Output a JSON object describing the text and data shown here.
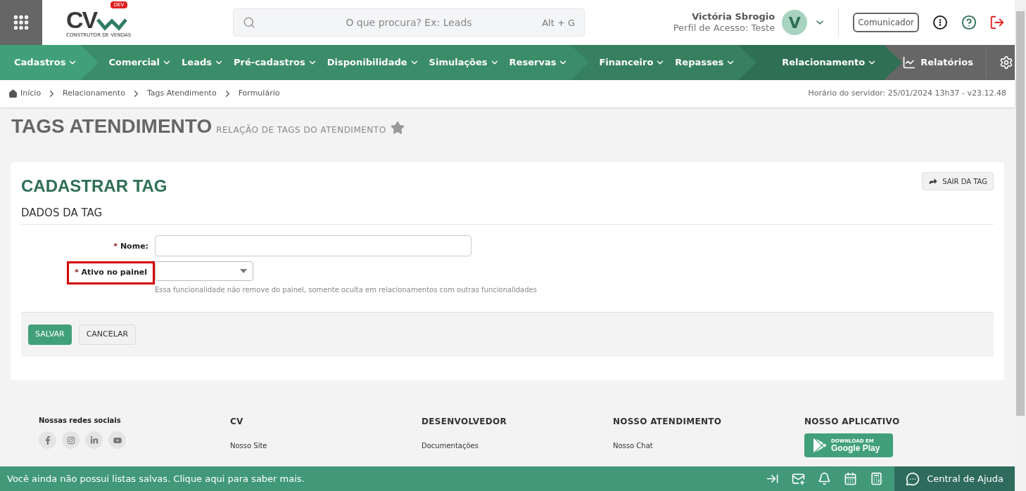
{
  "logo": {
    "letters": "CV",
    "badge": "DEV",
    "tagline": "CONSTRUTOR DE VENDAS"
  },
  "search": {
    "placeholder": "O que procura? Ex: Leads",
    "shortcut": "Alt + G"
  },
  "user": {
    "name": "Victória Sbrogio",
    "profile": "Perfil de Acesso: Teste",
    "initial": "V"
  },
  "header_button": "Comunicador",
  "nav": {
    "groups": [
      {
        "color": "#41a07a",
        "items": [
          "Cadastros"
        ]
      },
      {
        "color": "#3b8c69",
        "items": [
          "Comercial",
          "Leads",
          "Pré-cadastros",
          "Disponibilidade",
          "Simulações",
          "Reservas"
        ]
      },
      {
        "color": "#37805f",
        "items": [
          "Financeiro",
          "Repasses"
        ]
      },
      {
        "color": "#2f6f54",
        "items": [
          "Relacionamento"
        ]
      }
    ],
    "reports": "Relatórios"
  },
  "breadcrumb": [
    "Início",
    "Relacionamento",
    "Tags Atendimento",
    "Formulário"
  ],
  "server_time": "Horário do servidor: 25/01/2024 13h37 - v23.12.48",
  "page": {
    "title": "TAGS ATENDIMENTO",
    "subtitle": "RELAÇÃO DE TAGS DO ATENDIMENTO",
    "favorite": false
  },
  "card": {
    "title": "CADASTRAR TAG",
    "exit_button": "SAIR DA TAG",
    "section": "DADOS DA TAG",
    "fields": [
      {
        "kind": "text",
        "required_mark": "*",
        "label": "Nome:",
        "highlighted": false
      },
      {
        "kind": "select",
        "required_mark": "*",
        "label": "Ativo no painel",
        "highlighted": true,
        "help": "Essa funcionalidade não remove do painel, somente oculta em relacionamentos com outras funcionalidades"
      }
    ],
    "buttons": [
      {
        "label": "SALVAR",
        "primary": true
      },
      {
        "label": "CANCELAR",
        "primary": false
      }
    ]
  },
  "footer": {
    "social_title": "Nossas redes sociais",
    "columns": [
      {
        "title": "CV",
        "links": [
          "Nosso Site"
        ]
      },
      {
        "title": "DESENVOLVEDOR",
        "links": [
          "Documentações"
        ]
      },
      {
        "title": "NOSSO ATENDIMENTO",
        "links": [
          "Nosso Chat"
        ]
      }
    ],
    "app": {
      "title": "NOSSO APLICATIVO",
      "small": "DOWNLOAD EM",
      "store": "Google Play"
    }
  },
  "bottom_bar": {
    "message": "Você ainda não possui listas salvas. Clique aqui para saber mais.",
    "help": "Central de Ajuda"
  }
}
